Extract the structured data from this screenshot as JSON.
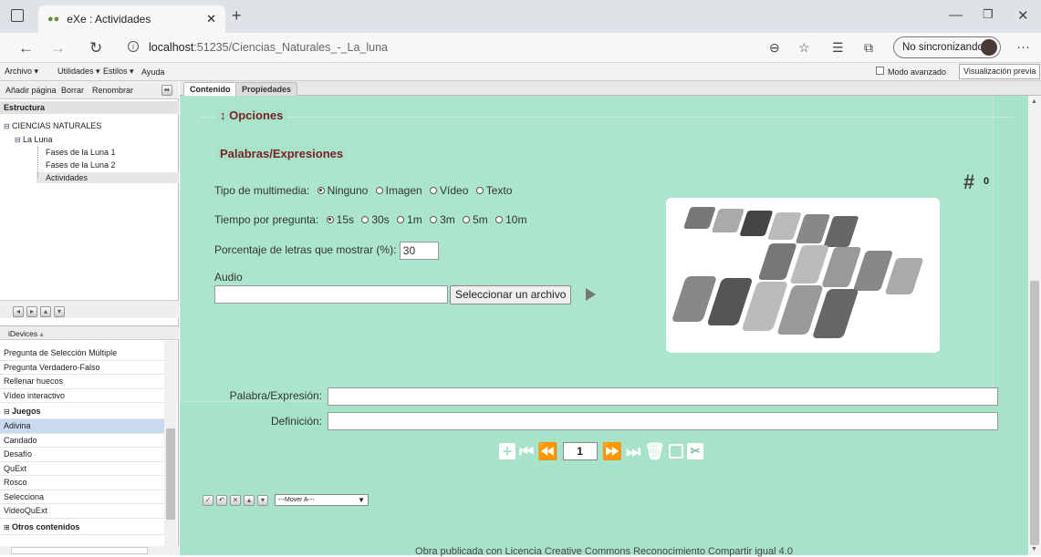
{
  "browser": {
    "tab_title": "eXe : Actividades",
    "url_host": "localhost",
    "url_rest": ":51235/Ciencias_Naturales_-_La_luna",
    "sync_label": "No sincronizando"
  },
  "menu": {
    "items": [
      "Archivo ▾",
      "Utilidades ▾",
      "Estilos ▾",
      "Ayuda"
    ],
    "advanced_mode": "Modo avanzado",
    "preview": "Visualización previa"
  },
  "left": {
    "toolbar": {
      "add": "Añadir página",
      "delete": "Borrar",
      "rename": "Renombrar"
    },
    "structure_header": "Estructura",
    "tree": [
      "CIENCIAS NATURALES",
      "La Luna",
      "Fases de la Luna 1",
      "Fases de la Luna 2",
      "Actividades"
    ],
    "idevices_header": "iDevices",
    "idevices": [
      "Pregunta de Selección Múltiple",
      "Pregunta Verdadero-Falso",
      "Rellenar huecos",
      "Vídeo interactivo"
    ],
    "games_header": "Juegos",
    "games": [
      "Adivina",
      "Candado",
      "Desafío",
      "QuExt",
      "Rosco",
      "Selecciona",
      "VideoQuExt"
    ],
    "others_header": "Otros contenidos"
  },
  "tabs": {
    "content": "Contenido",
    "properties": "Propiedades"
  },
  "options_legend": "Opciones",
  "words_legend": "Palabras/Expresiones",
  "form": {
    "media_label": "Tipo de multimedia:",
    "media_options": [
      "Ninguno",
      "Imagen",
      "Vídeo",
      "Texto"
    ],
    "media_selected": "Ninguno",
    "time_label": "Tiempo por pregunta:",
    "time_options": [
      "15s",
      "30s",
      "1m",
      "3m",
      "5m",
      "10m"
    ],
    "time_selected": "15s",
    "percent_label": "Porcentaje de letras que mostrar (%):",
    "percent_value": "30",
    "audio_label": "Audio",
    "audio_value": "",
    "select_file": "Seleccionar un archivo",
    "counter_symbol": "#",
    "counter_value": "0",
    "word_label": "Palabra/Expresión:",
    "word_value": "",
    "definition_label": "Definición:",
    "definition_value": "",
    "page_number": "1"
  },
  "bottom": {
    "move_select": "---Mover A---",
    "footer": "Obra publicada con Licencia Creative Commons Reconocimiento Compartir igual 4.0"
  }
}
